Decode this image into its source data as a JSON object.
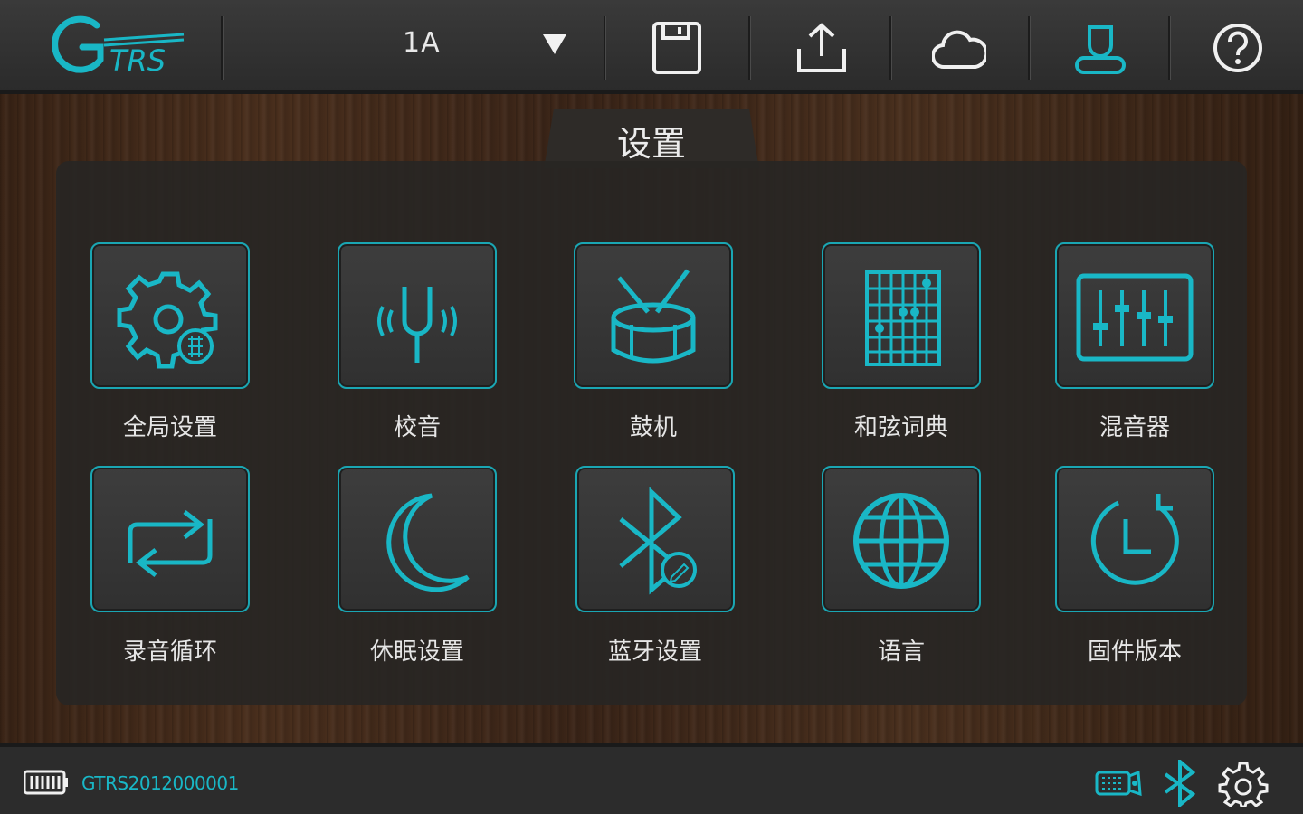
{
  "topbar": {
    "logo_text": "GTRS",
    "preset": "1A",
    "icons": [
      "save-icon",
      "upload-icon",
      "cloud-icon",
      "user-icon",
      "help-icon"
    ]
  },
  "page": {
    "title": "设置"
  },
  "menu": {
    "items": [
      {
        "label": "全局设置",
        "icon": "global-settings-icon"
      },
      {
        "label": "校音",
        "icon": "tuning-fork-icon"
      },
      {
        "label": "鼓机",
        "icon": "drum-icon"
      },
      {
        "label": "和弦词典",
        "icon": "chord-chart-icon"
      },
      {
        "label": "混音器",
        "icon": "mixer-icon"
      },
      {
        "label": "录音循环",
        "icon": "loop-icon"
      },
      {
        "label": "休眠设置",
        "icon": "moon-icon"
      },
      {
        "label": "蓝牙设置",
        "icon": "bluetooth-settings-icon"
      },
      {
        "label": "语言",
        "icon": "globe-icon"
      },
      {
        "label": "固件版本",
        "icon": "firmware-clock-icon"
      }
    ]
  },
  "bottombar": {
    "device_id": "GTRS2012000001",
    "icons": [
      "battery-icon",
      "guitar-connection-icon",
      "bluetooth-icon",
      "settings-gear-icon"
    ]
  },
  "colors": {
    "accent": "#1aa6b3",
    "text": "#e6e6e6",
    "topbar": "#333333"
  }
}
